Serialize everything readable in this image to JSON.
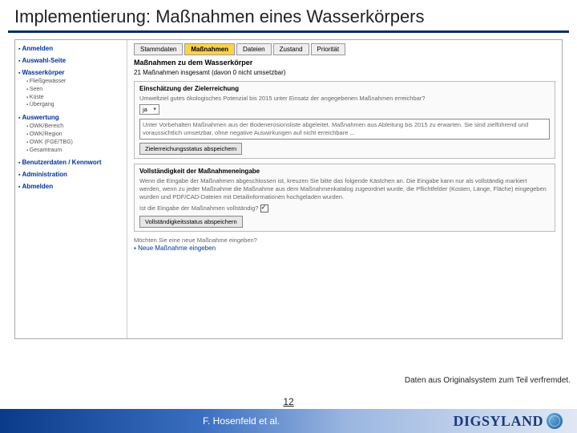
{
  "title": "Implementierung: Maßnahmen eines Wasserkörpers",
  "sidebar": {
    "anmelden": "Anmelden",
    "auswahl": "Auswahl-Seite",
    "wasserkoerper": "Wasserkörper",
    "wk_items": [
      "Fließgewässer",
      "Seen",
      "Küste",
      "Übergang"
    ],
    "auswertung": "Auswertung",
    "aus_items": [
      "OWK/Bereich",
      "OWK/Region",
      "OWK (FGE/TBG)",
      "Gesamtraum"
    ],
    "benutzer": "Benutzerdaten / Kennwort",
    "admin": "Administration",
    "abmelden": "Abmelden"
  },
  "tabs": {
    "stamm": "Stammdaten",
    "mass": "Maßnahmen",
    "datei": "Dateien",
    "zustand": "Zustand",
    "prio": "Priorität"
  },
  "main": {
    "h2": "Maßnahmen zu dem Wasserkörper",
    "summary": "21 Maßnahmen insgesamt (davon 0 nicht umsetzbar)",
    "p1_title": "Einschätzung der Zielerreichung",
    "p1_q": "Umweltziel gutes ökologisches Potenzial bis 2015 unter Einsatz der angegebenen Maßnahmen erreichbar?",
    "p1_sel": "ja",
    "p1_ta": "Unter Vorbehalten Maßnahmen aus der Bodenerosionsliste abgeleitet. Maßnahmen aus Ableitung bis 2015 zu erwarten. Sie sind zielführend und voraussichtlich umsetzbar, ohne negative Auswirkungen auf nicht erreichbare ...",
    "p1_btn": "Zielerreichungsstatus abspeichern",
    "p2_title": "Vollständigkeit der Maßnahmeneingabe",
    "p2_txt": "Wenn die Eingabe der Maßnahmen abgeschlossen ist, kreuzen Sie bitte das folgende Kästchen an. Die Eingabe kann nur als vollständig markiert werden, wenn zu jeder Maßnahme die Maßnahme aus dem Maßnahmenkatalog zugeordnet wurde, die Pflichtfelder (Kosten, Länge, Fläche) eingegeben wurden und PDF/CAD-Dateien mit Detailinformationen hochgeladen wurden.",
    "p2_chk_label": "Ist die Eingabe der Maßnahmen vollständig?",
    "p2_btn": "Vollständigkeitsstatus abspeichern",
    "new_q": "Möchten Sie eine neue Maßnahme eingeben?",
    "new_link": "Neue Maßnahme eingeben"
  },
  "disclaimer": "Daten aus Originalsystem zum Teil verfremdet.",
  "footer": {
    "page": "12",
    "author": "F. Hosenfeld et al.",
    "brand": "DIGSYLAND"
  }
}
